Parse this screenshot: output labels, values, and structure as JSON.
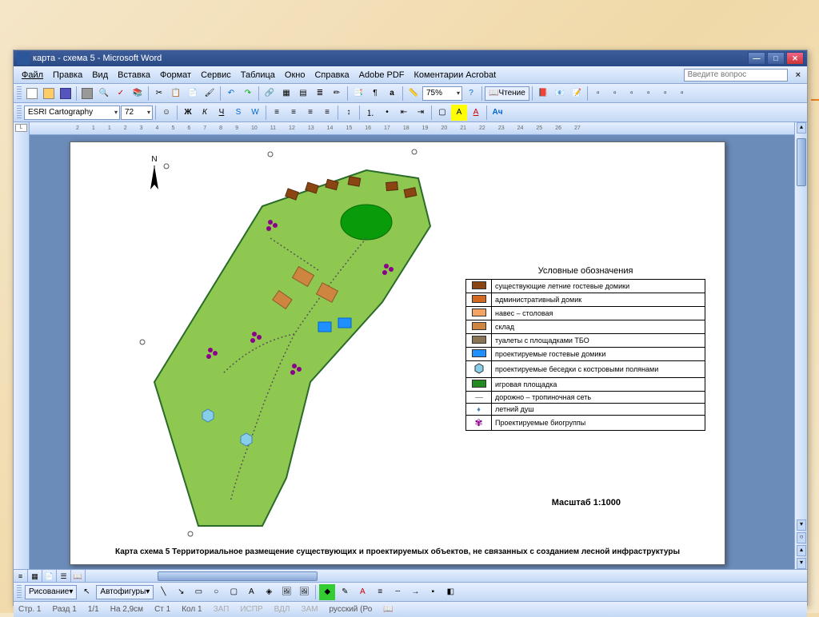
{
  "window": {
    "title": "карта - схема 5 - Microsoft Word"
  },
  "menu": {
    "file": "Файл",
    "edit": "Правка",
    "view": "Вид",
    "insert": "Вставка",
    "format": "Формат",
    "service": "Сервис",
    "table": "Таблица",
    "window": "Окно",
    "help": "Справка",
    "adobe": "Adobe PDF",
    "acrobat": "Коментарии Acrobat",
    "ask_placeholder": "Введите вопрос"
  },
  "toolbar": {
    "zoom": "75%",
    "read_label": "Чтение",
    "font_name": "ESRI Cartography",
    "font_size": "72"
  },
  "drawing": {
    "label": "Рисование",
    "autoshapes": "Автофигуры"
  },
  "status": {
    "page": "Стр. 1",
    "section": "Разд 1",
    "pages": "1/1",
    "at": "На 2,9см",
    "line": "Ст 1",
    "col": "Кол 1",
    "rec": "ЗАП",
    "trk": "ИСПР",
    "ext": "ВДЛ",
    "ovr": "ЗАМ",
    "lang": "русский (Ро"
  },
  "document": {
    "north_label": "N",
    "legend_title": "Условные обозначения",
    "legend": [
      {
        "label": "существующие летние гостевые домики",
        "color": "#8b4513"
      },
      {
        "label": "административный домик",
        "color": "#d2691e"
      },
      {
        "label": "навес – столовая",
        "color": "#f4a460"
      },
      {
        "label": "склад",
        "color": "#cd853f"
      },
      {
        "label": "туалеты с площадками ТБО",
        "color": "#8b7355"
      },
      {
        "label": "проектируемые гостевые домики",
        "color": "#1e90ff"
      },
      {
        "label": "проектируемые беседки с костровыми полянами",
        "color": "#87ceeb"
      },
      {
        "label": "игровая площадка",
        "color": "#228b22"
      },
      {
        "label": "дорожно – тропиночная сеть",
        "color": "#888"
      },
      {
        "label": "летний душ",
        "color": "#4682b4"
      },
      {
        "label": "Проектируемые биогруппы",
        "color": "#8b008b"
      }
    ],
    "scale": "Масштаб 1:1000",
    "caption": "Карта схема 5 Территориальное размещение существующих и проектируемых объектов, не связанных с созданием лесной инфраструктуры"
  },
  "ruler": [
    "2",
    "1",
    "1",
    "2",
    "3",
    "4",
    "5",
    "6",
    "7",
    "8",
    "9",
    "10",
    "11",
    "12",
    "13",
    "14",
    "15",
    "16",
    "17",
    "18",
    "19",
    "20",
    "21",
    "22",
    "23",
    "24",
    "25",
    "26",
    "27"
  ]
}
